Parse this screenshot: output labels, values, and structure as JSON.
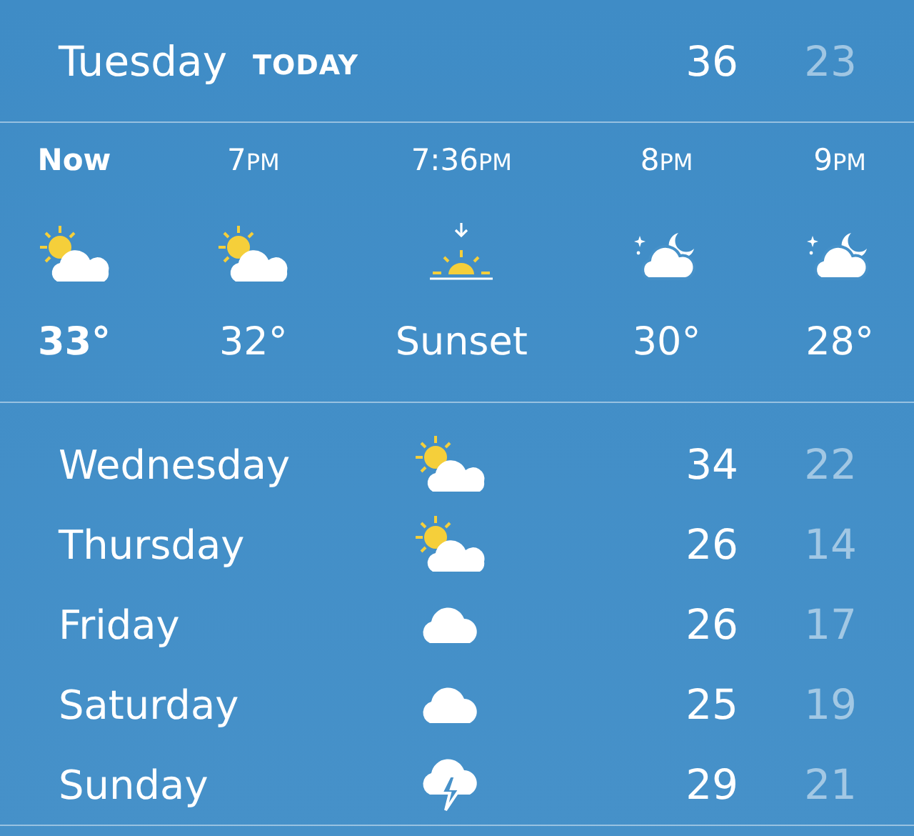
{
  "today": {
    "day": "Tuesday",
    "label": "TODAY",
    "high": "36",
    "low": "23"
  },
  "hourly": [
    {
      "time": "Now",
      "value": "33°",
      "kind": "partly-sunny",
      "current": true
    },
    {
      "time": "7PM",
      "value": "32°",
      "kind": "partly-sunny",
      "current": false
    },
    {
      "time": "7:36PM",
      "value": "Sunset",
      "kind": "sunset",
      "current": false
    },
    {
      "time": "8PM",
      "value": "30°",
      "kind": "night",
      "current": false
    },
    {
      "time": "9PM",
      "value": "28°",
      "kind": "night",
      "current": false
    }
  ],
  "daily": [
    {
      "day": "Wednesday",
      "kind": "partly-sunny",
      "high": "34",
      "low": "22"
    },
    {
      "day": "Thursday",
      "kind": "partly-sunny",
      "high": "26",
      "low": "14"
    },
    {
      "day": "Friday",
      "kind": "cloudy",
      "high": "26",
      "low": "17"
    },
    {
      "day": "Saturday",
      "kind": "cloudy",
      "high": "25",
      "low": "19"
    },
    {
      "day": "Sunday",
      "kind": "storm",
      "high": "29",
      "low": "21"
    }
  ]
}
